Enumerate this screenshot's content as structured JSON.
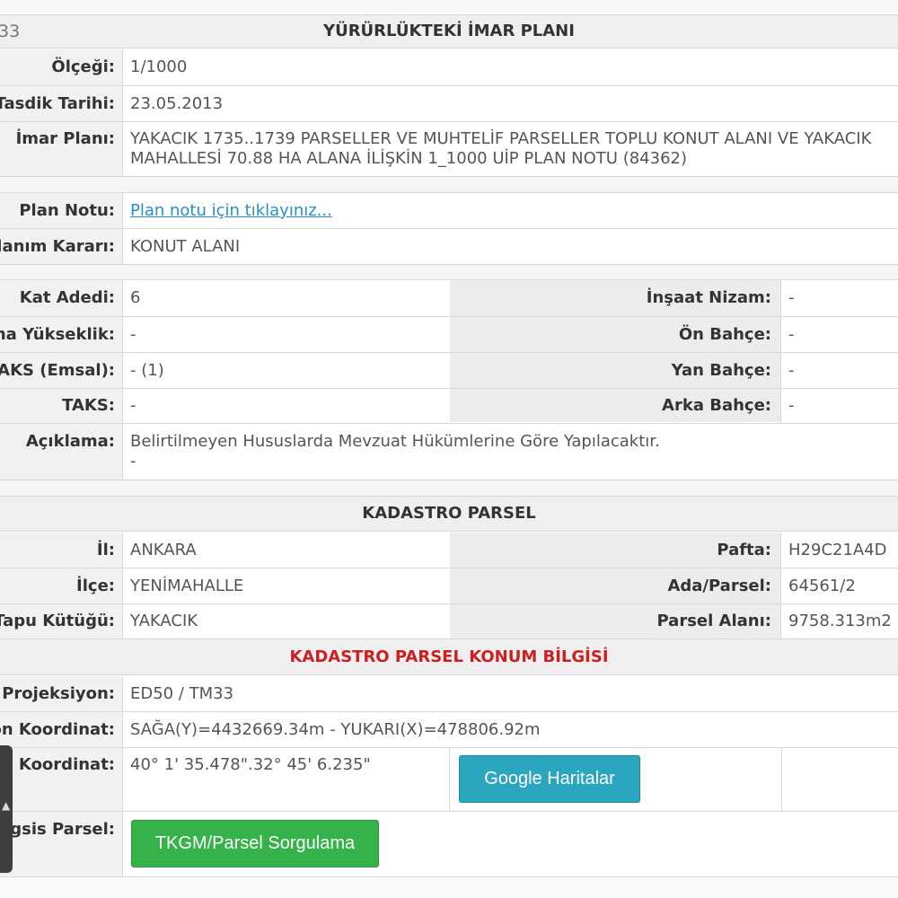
{
  "imar": {
    "code_fragment": "33",
    "title": "YÜRÜRLÜKTEKİ İMAR PLANI",
    "olcegi_label": "Ölçeği:",
    "olcegi_value": "1/1000",
    "tasdik_label": "Tasdik Tarihi:",
    "tasdik_value": "23.05.2013",
    "plan_label": "İmar Planı:",
    "plan_value_line1": "YAKACIK 1735..1739 PARSELLER VE MUHTELİF PARSELLER TOPLU KONUT ALANI VE YAKACIK",
    "plan_value_line2": "MAHALLESİ 70.88 HA ALANA İLİŞKİN 1_1000 UİP PLAN NOTU (84362)",
    "plan_notu_label": "Plan Notu:",
    "plan_notu_link": "Plan notu için tıklayınız...",
    "kullanim_label": "Kullanım Kararı:",
    "kullanim_value": "KONUT ALANI",
    "kat_label": "Kat Adedi:",
    "kat_value": "6",
    "insaat_label": "İnşaat Nizam:",
    "insaat_value": "-",
    "yukseklik_label": "Bina Yükseklik:",
    "yukseklik_value": "-",
    "on_bahce_label": "Ön Bahçe:",
    "on_bahce_value": "-",
    "kaks_label": "KAKS (Emsal):",
    "kaks_value": "- (1)",
    "yan_bahce_label": "Yan Bahçe:",
    "yan_bahce_value": "-",
    "taks_label": "TAKS:",
    "taks_value": "-",
    "arka_bahce_label": "Arka Bahçe:",
    "arka_bahce_value": "-",
    "aciklama_label": "Açıklama:",
    "aciklama_line1": "Belirtilmeyen Hususlarda Mevzuat Hükümlerine Göre Yapılacaktır.",
    "aciklama_line2": "-"
  },
  "kadastro": {
    "title": "KADASTRO PARSEL",
    "il_label": "İl:",
    "il_value": "ANKARA",
    "pafta_label": "Pafta:",
    "pafta_value": "H29C21A4D",
    "ilce_label": "İlçe:",
    "ilce_value": "YENİMAHALLE",
    "ada_label": "Ada/Parsel:",
    "ada_value": "64561/2",
    "tapu_label": "Tapu Kütüğü:",
    "tapu_value": "YAKACIK",
    "alan_label": "Parsel Alanı:",
    "alan_value": "9758.313m2"
  },
  "konum": {
    "title": "KADASTRO PARSEL KONUM BİLGİSİ",
    "proj_label": "Projeksiyon:",
    "proj_value": "ED50 / TM33",
    "koord_label": "Projeksiyon Koordinat:",
    "koord_value": "SAĞA(Y)=4432669.34m - YUKARI(X)=478806.92m",
    "cog_label": "Coğrafi Koordinat:",
    "cog_value": "40° 1' 35.478\".32° 45' 6.235\"",
    "google_button": "Google Haritalar",
    "tkgm_label": "Tkgm Megsis Parsel:",
    "tkgm_button": "TKGM/Parsel Sorgulama"
  },
  "colors": {
    "accent_red": "#cc1f1f",
    "link_blue": "#2a8fc4",
    "button_blue": "#2aa6bf",
    "button_green": "#36b24a"
  }
}
